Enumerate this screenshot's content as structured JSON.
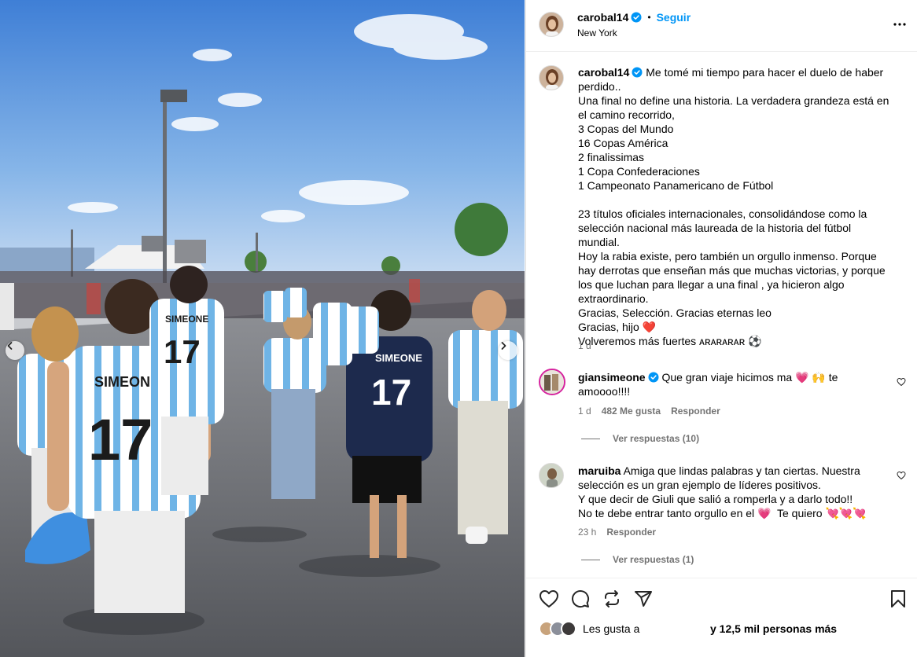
{
  "post": {
    "username": "carobal14",
    "follow_label": "Seguir",
    "location": "New York"
  },
  "caption": {
    "username": "carobal14",
    "text": "Me tomé mi tiempo para hacer el duelo de haber perdido..\nUna final no define una historia. La verdadera grandeza está en el camino recorrido,\n3 Copas del Mundo\n16 Copas América\n2 finalissimas\n1 Copa Confederaciones\n1 Campeonato Panamericano de Fútbol\n\n23 títulos oficiales internacionales, consolidándose como la selección nacional más laureada de la historia del fútbol mundial.\nHoy la rabia existe, pero también un orgullo inmenso. Porque hay derrotas que enseñan más que muchas victorias, y porque los que luchan para llegar a una final , ya hicieron algo extraordinario.\nGracias, Selección. Gracias eternas leo\nGracias, hijo ❤️\nVolveremos más fuertes ᴀʀᴀʀᴀʀᴀʀ ⚽",
    "time": "1 d"
  },
  "comments": [
    {
      "username": "giansimeone",
      "text": "Que gran viaje hicimos ma 💗 🙌 te amoooo!!!!",
      "time": "1 d",
      "likes": "482 Me gusta",
      "reply_label": "Responder",
      "view_replies": "Ver respuestas (10)"
    },
    {
      "username": "maruiba",
      "text": "Amiga que lindas palabras y tan ciertas. Nuestra selección es un gran ejemplo de líderes positivos.\nY que decir de Giuli que salió a romperla y a darlo todo!!\nNo te debe entrar tanto orgullo en el 💗  Te quiero 💘💘💘",
      "time": "23 h",
      "reply_label": "Responder",
      "view_replies": "Ver respuestas (1)"
    }
  ],
  "likes": {
    "prefix": "Les gusta a",
    "suffix": "y 12,5 mil personas más"
  },
  "icons": {
    "more": "more-options-icon",
    "verified": "verified-badge-icon",
    "like": "heart-icon",
    "comment": "comment-icon",
    "share": "repost-icon",
    "send": "send-icon",
    "save": "bookmark-icon",
    "prev": "chevron-left-icon",
    "next": "chevron-right-icon"
  },
  "colors": {
    "link": "#0095f6",
    "verified": "#0095f6",
    "secondary_text": "#737373",
    "border": "#dbdbdb"
  }
}
